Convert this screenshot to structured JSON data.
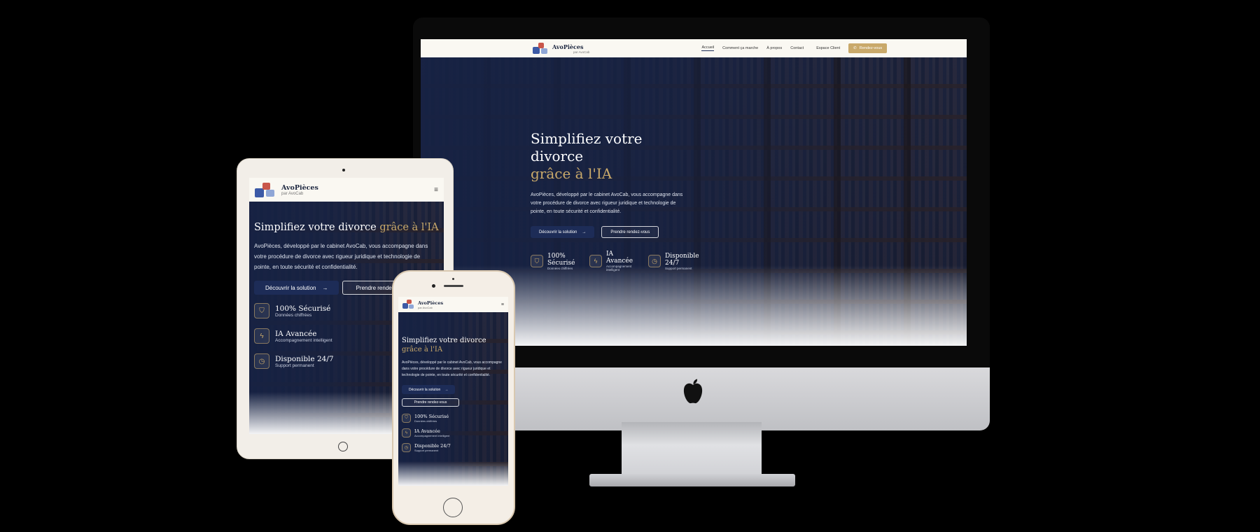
{
  "site": {
    "brand": "AvoPièces",
    "brand_sub": "par AvoCab",
    "nav": {
      "items": [
        "Accueil",
        "Comment ça marche",
        "À propos",
        "Contact"
      ],
      "client_space": "Espace Client",
      "cta": "Rendez-vous"
    },
    "hero": {
      "title_line1": "Simplifiez votre divorce",
      "title_line2": "grâce à l'IA",
      "title_inline_white": "Simplifiez votre divorce ",
      "description": "AvoPièces, développé par le cabinet AvoCab, vous accompagne dans votre procédure de divorce avec rigueur juridique et technologie de pointe, en toute sécurité et confidentialité.",
      "primary_button": "Découvrir la solution",
      "secondary_button": "Prendre rendez-vous",
      "features": [
        {
          "title": "100% Sécurisé",
          "subtitle": "Données chiffrées",
          "icon": "shield-icon"
        },
        {
          "title": "IA Avancée",
          "subtitle": "Accompagnement intelligent",
          "icon": "bolt-icon"
        },
        {
          "title": "Disponible 24/7",
          "subtitle": "Support permanent",
          "icon": "clock-icon"
        }
      ]
    },
    "colors": {
      "navy": "#1d2c57",
      "gold": "#c9a96a",
      "cream": "#faf8f2"
    }
  }
}
